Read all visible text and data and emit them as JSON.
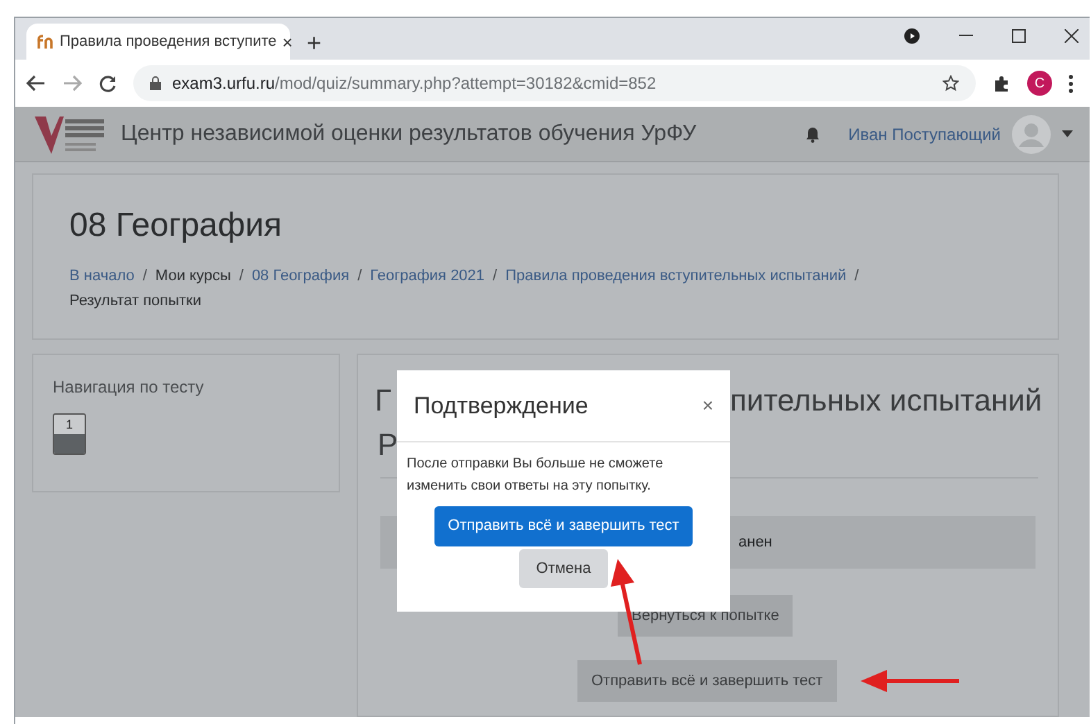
{
  "browser": {
    "tab_title": "Правила проведения вступите",
    "tab_close": "×",
    "new_tab": "+",
    "url_host": "exam3.urfu.ru",
    "url_path": "/mod/quiz/summary.php?attempt=30182&cmid=852",
    "profile_initial": "C"
  },
  "site_header": {
    "title": "Центр независимой оценки результатов обучения УрФУ",
    "user": "Иван Поступающий"
  },
  "page_header": {
    "heading": "08 География",
    "breadcrumbs": [
      {
        "text": "В начало",
        "link": true
      },
      {
        "separator": "/",
        "text": "Мои курсы",
        "link": false
      },
      {
        "separator": "/",
        "text": "08 География",
        "link": true
      },
      {
        "separator": "/",
        "text": "География 2021",
        "link": true
      },
      {
        "separator": "/",
        "text": "Правила проведения вступительных испытаний",
        "link": true
      },
      {
        "separator": "/",
        "text": "Результат попытки",
        "link": false
      }
    ]
  },
  "quiz_navigation": {
    "title": "Навигация по тесту",
    "questions": [
      {
        "label": "1",
        "answered": true
      }
    ]
  },
  "main": {
    "heading_start": "Г",
    "heading_end": "пительных испытаний",
    "heading_line2": "Р",
    "table_cell": "анен",
    "return_button": "Вернуться к попытке",
    "submit_button": "Отправить всё и завершить тест"
  },
  "modal": {
    "title": "Подтверждение",
    "close": "×",
    "body": "После отправки Вы больше не сможете изменить свои ответы на эту попытку.",
    "confirm": "Отправить всё и завершить тест",
    "cancel": "Отмена"
  }
}
